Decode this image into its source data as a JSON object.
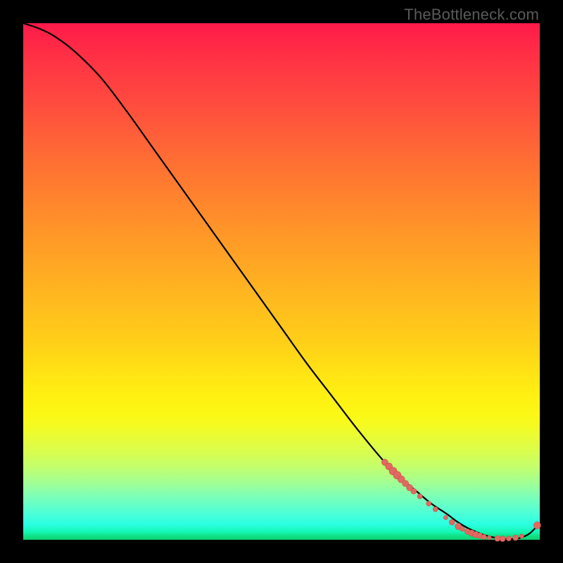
{
  "watermark": "TheBottleneck.com",
  "colors": {
    "curve_stroke": "#000000",
    "dot_fill": "#e06a62",
    "dot_stroke": "#c94f47"
  },
  "chart_data": {
    "type": "line",
    "title": "",
    "xlabel": "",
    "ylabel": "",
    "xlim": [
      0,
      100
    ],
    "ylim": [
      0,
      100
    ],
    "grid": false,
    "series": [
      {
        "name": "bottleneck-curve",
        "x": [
          0,
          3,
          6,
          10,
          15,
          20,
          25,
          30,
          35,
          40,
          45,
          50,
          55,
          60,
          65,
          70,
          73,
          76,
          79,
          82,
          84,
          86,
          88,
          90,
          92,
          94,
          96,
          98,
          100
        ],
        "y": [
          100,
          99,
          97.5,
          94.5,
          89.5,
          83,
          76,
          69,
          62,
          55,
          48,
          41,
          34,
          27.5,
          21,
          15,
          12,
          9.5,
          7,
          5,
          3.5,
          2.3,
          1.4,
          0.7,
          0.3,
          0.15,
          0.3,
          1.2,
          3.2
        ]
      }
    ],
    "scatter_overlay": {
      "name": "highlighted-points",
      "points": [
        {
          "x": 70.0,
          "y": 15.0,
          "r": 4.5
        },
        {
          "x": 70.8,
          "y": 14.2,
          "r": 5.0
        },
        {
          "x": 71.6,
          "y": 13.3,
          "r": 5.5
        },
        {
          "x": 72.4,
          "y": 12.5,
          "r": 5.5
        },
        {
          "x": 73.2,
          "y": 11.7,
          "r": 5.0
        },
        {
          "x": 74.0,
          "y": 10.9,
          "r": 4.5
        },
        {
          "x": 74.8,
          "y": 10.1,
          "r": 4.5
        },
        {
          "x": 75.6,
          "y": 9.4,
          "r": 4.0
        },
        {
          "x": 76.8,
          "y": 8.4,
          "r": 3.5
        },
        {
          "x": 78.5,
          "y": 7.0,
          "r": 3.5
        },
        {
          "x": 79.8,
          "y": 5.9,
          "r": 3.5
        },
        {
          "x": 81.8,
          "y": 4.3,
          "r": 3.0
        },
        {
          "x": 83.0,
          "y": 3.4,
          "r": 4.0
        },
        {
          "x": 84.2,
          "y": 2.6,
          "r": 4.5
        },
        {
          "x": 85.0,
          "y": 2.1,
          "r": 3.5
        },
        {
          "x": 86.0,
          "y": 1.6,
          "r": 4.0
        },
        {
          "x": 86.8,
          "y": 1.3,
          "r": 4.5
        },
        {
          "x": 87.6,
          "y": 1.0,
          "r": 4.5
        },
        {
          "x": 88.4,
          "y": 0.8,
          "r": 4.0
        },
        {
          "x": 89.2,
          "y": 0.55,
          "r": 3.5
        },
        {
          "x": 90.2,
          "y": 0.4,
          "r": 3.0
        },
        {
          "x": 91.8,
          "y": 0.25,
          "r": 4.0
        },
        {
          "x": 92.8,
          "y": 0.2,
          "r": 4.0
        },
        {
          "x": 94.0,
          "y": 0.25,
          "r": 3.5
        },
        {
          "x": 95.3,
          "y": 0.4,
          "r": 4.0
        },
        {
          "x": 96.5,
          "y": 0.7,
          "r": 3.0
        },
        {
          "x": 99.5,
          "y": 2.8,
          "r": 5.0
        }
      ]
    }
  }
}
